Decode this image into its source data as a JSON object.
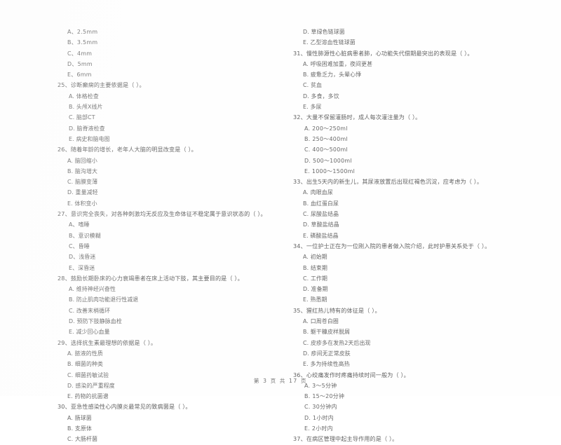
{
  "document": {
    "type": "exam-paper",
    "language": "zh-CN",
    "footer": "第 3 页 共 17 页"
  },
  "left_column": {
    "continued_options": [
      "A、2.5mm",
      "B、3.5mm",
      "C、4mm",
      "D、5mm",
      "E、6mm"
    ],
    "questions": [
      {
        "number": "25",
        "stem": "25、诊断癫痫的主要依据是（     ）。",
        "options": [
          "A. 体格检查",
          "B. 头颅X线片",
          "C. 脑部CT",
          "D. 脑脊液检查",
          "E. 病史和脑电图"
        ]
      },
      {
        "number": "26",
        "stem": "26、随着年龄的增长，老年人大脑的明显改变是（     ）。",
        "options": [
          "A. 脑回缩小",
          "B. 脑沟增大",
          "C. 脑膜变薄",
          "D. 重量减轻",
          "E. 体积变小"
        ]
      },
      {
        "number": "27",
        "stem": "27、意识完全丧失，对各种刺激均无反应及生命体征不稳定属于意识状态的（     ）。",
        "options": [
          "A、嗜睡",
          "B、意识模糊",
          "C、昏睡",
          "D、浅昏迷",
          "E、深昏迷"
        ]
      },
      {
        "number": "28",
        "stem": "28、鼓励长期卧床的心力衰竭患者在床上活动下肢，其主要目的是（     ）。",
        "options": [
          "A. 维持神经兴奋性",
          "B. 防止肌肉功能退行性减退",
          "C. 改善末梢循环",
          "D. 预防下肢静脉血栓",
          "E. 减少回心血量"
        ]
      },
      {
        "number": "29",
        "stem": "29、选择抗生素最理想的依据是（     ）。",
        "options": [
          "A. 脓液的性质",
          "B. 细菌的种类",
          "C. 细菌药敏试验",
          "D. 感染的严重程度",
          "E. 药物的抗菌谱"
        ]
      },
      {
        "number": "30",
        "stem": "30、亚急性感染性心内膜炎最常见的致病菌是（     ）。",
        "options": [
          "A. 肠球菌",
          "B. 支原体",
          "C. 大肠杆菌"
        ]
      }
    ]
  },
  "right_column": {
    "continued_options": [
      "D. 草绿色链球菌",
      "E. 乙型溶血性链球菌"
    ],
    "questions": [
      {
        "number": "31",
        "stem": "31、慢性肺源性心脏病患者肺，心功能失代偿期最突出的表现是（     ）。",
        "options": [
          "A. 呼吸困难加重，夜间更甚",
          "B. 疲惫乏力，头晕心悸",
          "C. 贫血",
          "D. 多食，多饮",
          "E. 多尿"
        ]
      },
      {
        "number": "32",
        "stem": "32、大量不保留灌肠时，成人每次灌注量为（     ）。",
        "options": [
          "A. 200～250ml",
          "B. 250～400ml",
          "C. 400～500ml",
          "D. 500～1000ml",
          "E. 1000～1500ml"
        ]
      },
      {
        "number": "33",
        "stem": "33、出生5天内的新生儿，其尿液放置后出现红褐色沉淀，应考虑为（     ）。",
        "options": [
          "A. 肉眼血尿",
          "B. 血红蛋白尿",
          "C. 尿酸盐结晶",
          "D. 草酸盐结晶",
          "E. 磷酸盐结晶"
        ]
      },
      {
        "number": "34",
        "stem": "34、一位护士正在为一位刚入院的患者做入院介绍，此时护患关系处于（     ）。",
        "options": [
          "A. 初始期",
          "B. 结束期",
          "C. 工作期",
          "D. 准备期",
          "E. 熟悉期"
        ]
      },
      {
        "number": "35",
        "stem": "35、猩红热儿特有的体征是（     ）。",
        "options": [
          "A. 口周苍白圈",
          "B. 躯干糠皮样脱屑",
          "C. 皮疹多在发热2天后出现",
          "D. 疹间无正常皮肤",
          "E. 多为持续性高热"
        ]
      },
      {
        "number": "36",
        "stem": "36、心绞痛发作时疼痛持续时间一般为（     ）。",
        "options": [
          "A. 3～5分钟",
          "B. 15～20分钟",
          "C. 30分钟内",
          "D. 1小时内",
          "E. 2小时内"
        ]
      },
      {
        "number": "37",
        "stem": "37、在病区管理中起主导作用的是（     ）。",
        "options": []
      }
    ]
  }
}
